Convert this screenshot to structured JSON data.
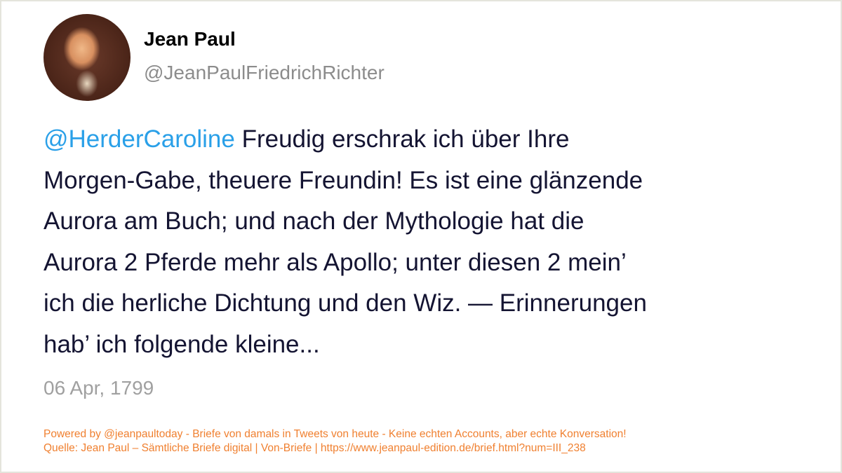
{
  "author": {
    "name": "Jean Paul",
    "handle": "@JeanPaulFriedrichRichter",
    "avatar_icon": "portrait-avatar"
  },
  "tweet": {
    "mention": "@HerderCaroline",
    "lines": [
      " Freudig erschrak ich über Ihre",
      "Morgen-Gabe, theuere Freundin! Es ist eine glänzende",
      "Aurora am Buch; und nach der Mythologie hat die",
      "Aurora 2 Pferde mehr als Apollo; unter diesen 2 mein’",
      "ich die herliche Dichtung und den Wiz. — Erinnerungen",
      "hab’ ich folgende kleine..."
    ],
    "date": "06 Apr, 1799"
  },
  "footer": {
    "line1": "Powered by @jeanpaultoday - Briefe von damals in Tweets von heute - Keine echten Accounts, aber echte Konversation!",
    "line2": "Quelle: Jean Paul – Sämtliche Briefe digital | Von-Briefe | https://www.jeanpaul-edition.de/brief.html?num=III_238"
  },
  "colors": {
    "mention": "#2aa0e8",
    "footer": "#f08030",
    "text": "#141432",
    "muted": "#a0a0a0"
  }
}
